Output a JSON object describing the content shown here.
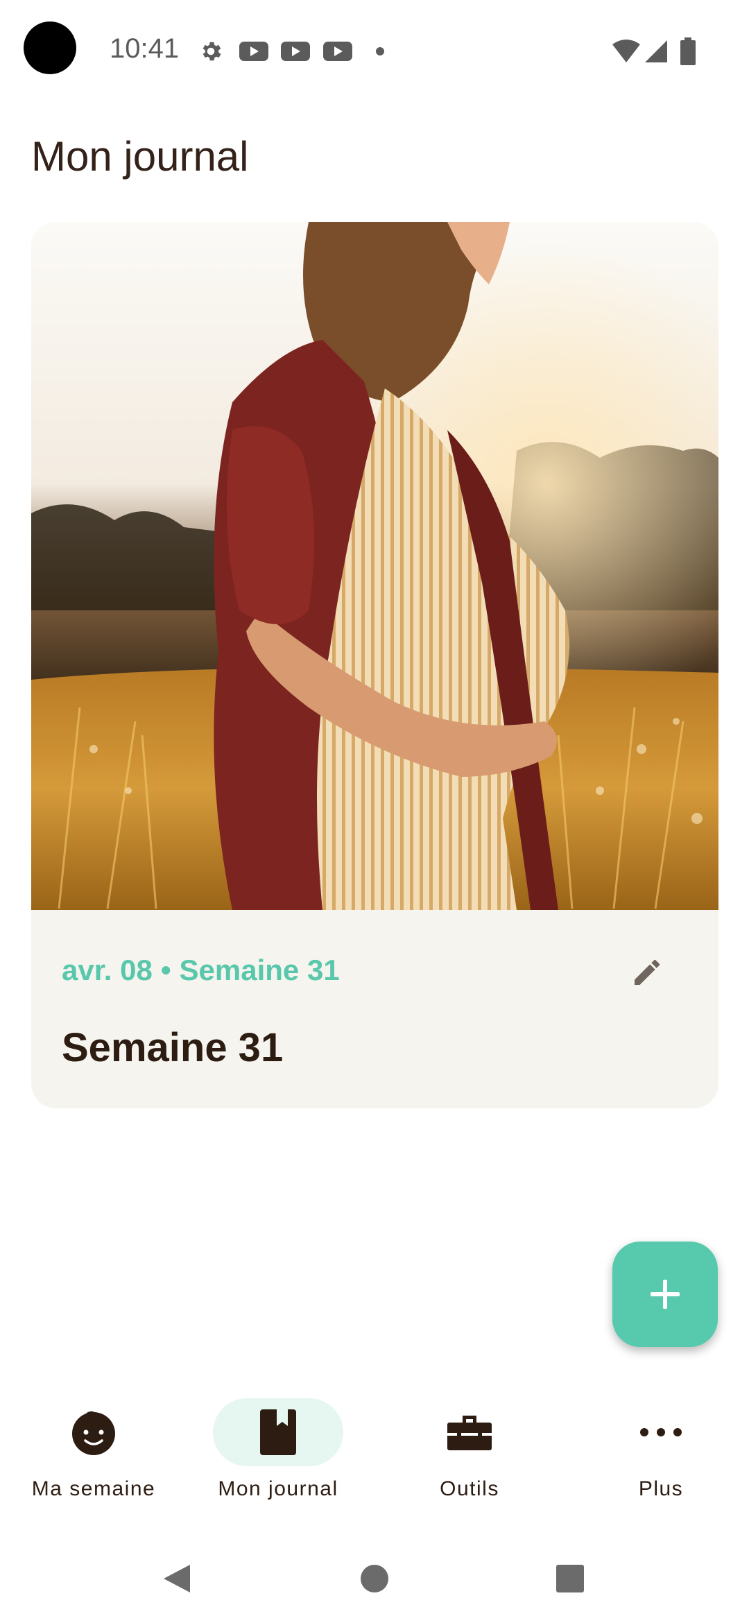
{
  "status_bar": {
    "time": "10:41",
    "icons": [
      "settings-icon",
      "youtube-icon",
      "youtube-icon",
      "youtube-icon",
      "dot-icon",
      "wifi-icon",
      "signal-icon",
      "battery-icon"
    ]
  },
  "page": {
    "title": "Mon journal"
  },
  "journal_entry": {
    "date": "avr. 08",
    "separator": "•",
    "week_tag": "Semaine 31",
    "title": "Semaine 31",
    "photo": "pregnant-woman-in-field-photo",
    "edit_icon": "pencil-icon"
  },
  "fab": {
    "icon": "plus-icon"
  },
  "bottom_nav": {
    "items": [
      {
        "label": "Ma semaine",
        "icon": "baby-face-icon",
        "active": false
      },
      {
        "label": "Mon journal",
        "icon": "book-icon",
        "active": true
      },
      {
        "label": "Outils",
        "icon": "toolbox-icon",
        "active": false
      },
      {
        "label": "Plus",
        "icon": "more-dots-icon",
        "active": false
      }
    ]
  },
  "system_nav": {
    "icons": [
      "back-icon",
      "home-icon",
      "recents-icon"
    ]
  },
  "colors": {
    "accent": "#57c9ad",
    "accent_text": "#58c7ab",
    "title_text": "#34221a",
    "card_bg": "#f5f4ee",
    "nav_active_bg": "#e6f6f1"
  }
}
